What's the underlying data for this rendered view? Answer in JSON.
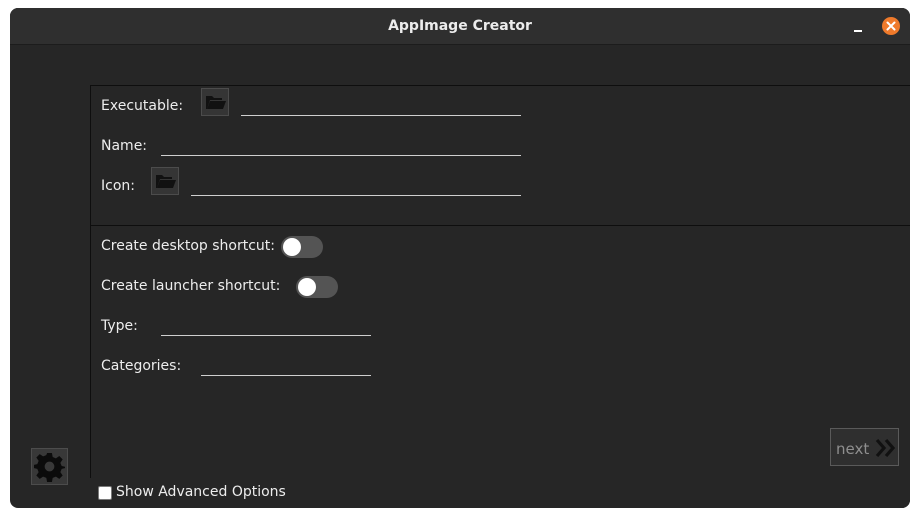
{
  "window": {
    "title": "AppImage Creator"
  },
  "form": {
    "executable_label": "Executable:",
    "executable_value": "",
    "name_label": "Name:",
    "name_value": "",
    "icon_label": "Icon:",
    "icon_value": "",
    "desktop_shortcut_label": "Create desktop shortcut:",
    "desktop_shortcut_on": false,
    "launcher_shortcut_label": "Create launcher shortcut:",
    "launcher_shortcut_on": false,
    "type_label": "Type:",
    "type_value": "",
    "categories_label": "Categories:",
    "categories_value": ""
  },
  "footer": {
    "next_label": "next",
    "show_advanced_label": "Show Advanced Options",
    "show_advanced_checked": false
  },
  "icons": {
    "folder": "folder-open-icon",
    "settings": "gear-icon",
    "next": "double-chevron-right-icon",
    "close": "close-icon",
    "minimize": "minimize-icon"
  },
  "colors": {
    "window_bg": "#262626",
    "titlebar_bg": "#2f2f2f",
    "close_accent": "#ef7a2b",
    "text": "#ededed",
    "toggle_off": "#545454"
  }
}
